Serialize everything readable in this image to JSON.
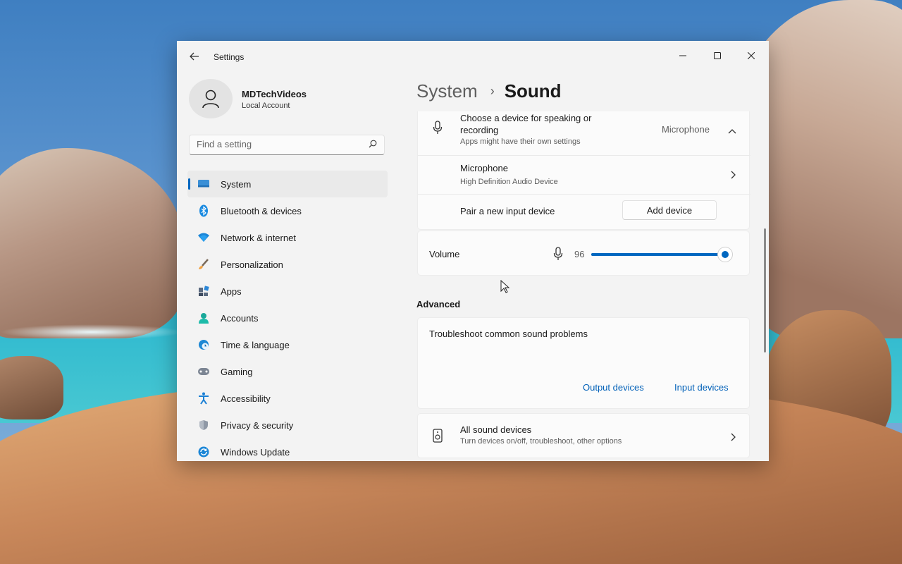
{
  "window": {
    "title": "Settings"
  },
  "user": {
    "name": "MDTechVideos",
    "account_type": "Local Account"
  },
  "search": {
    "placeholder": "Find a setting",
    "icon": "search-icon"
  },
  "sidebar": {
    "items": [
      {
        "label": "System",
        "icon": "system-icon",
        "active": true
      },
      {
        "label": "Bluetooth & devices",
        "icon": "bluetooth-icon"
      },
      {
        "label": "Network & internet",
        "icon": "wifi-icon"
      },
      {
        "label": "Personalization",
        "icon": "brush-icon"
      },
      {
        "label": "Apps",
        "icon": "apps-icon"
      },
      {
        "label": "Accounts",
        "icon": "accounts-icon"
      },
      {
        "label": "Time & language",
        "icon": "globe-clock-icon"
      },
      {
        "label": "Gaming",
        "icon": "gamepad-icon"
      },
      {
        "label": "Accessibility",
        "icon": "accessibility-icon"
      },
      {
        "label": "Privacy & security",
        "icon": "shield-icon"
      },
      {
        "label": "Windows Update",
        "icon": "update-icon"
      }
    ]
  },
  "breadcrumb": {
    "parent": "System",
    "separator": "›",
    "current": "Sound"
  },
  "input": {
    "choose_title": "Choose a device for speaking or recording",
    "choose_subtitle": "Apps might have their own settings",
    "selected_device": "Microphone",
    "device_name": "Microphone",
    "device_desc": "High Definition Audio Device",
    "pair_label": "Pair a new input device",
    "add_button": "Add device"
  },
  "volume": {
    "label": "Volume",
    "value": "96",
    "level": 0.96
  },
  "advanced": {
    "heading": "Advanced",
    "troubleshoot_label": "Troubleshoot common sound problems",
    "output_link": "Output devices",
    "input_link": "Input devices",
    "all_devices_title": "All sound devices",
    "all_devices_subtitle": "Turn devices on/off, troubleshoot, other options"
  },
  "colors": {
    "accent": "#0067c0",
    "link": "#0060b8",
    "window_bg": "#f3f3f3",
    "card_bg": "#fbfbfb"
  }
}
